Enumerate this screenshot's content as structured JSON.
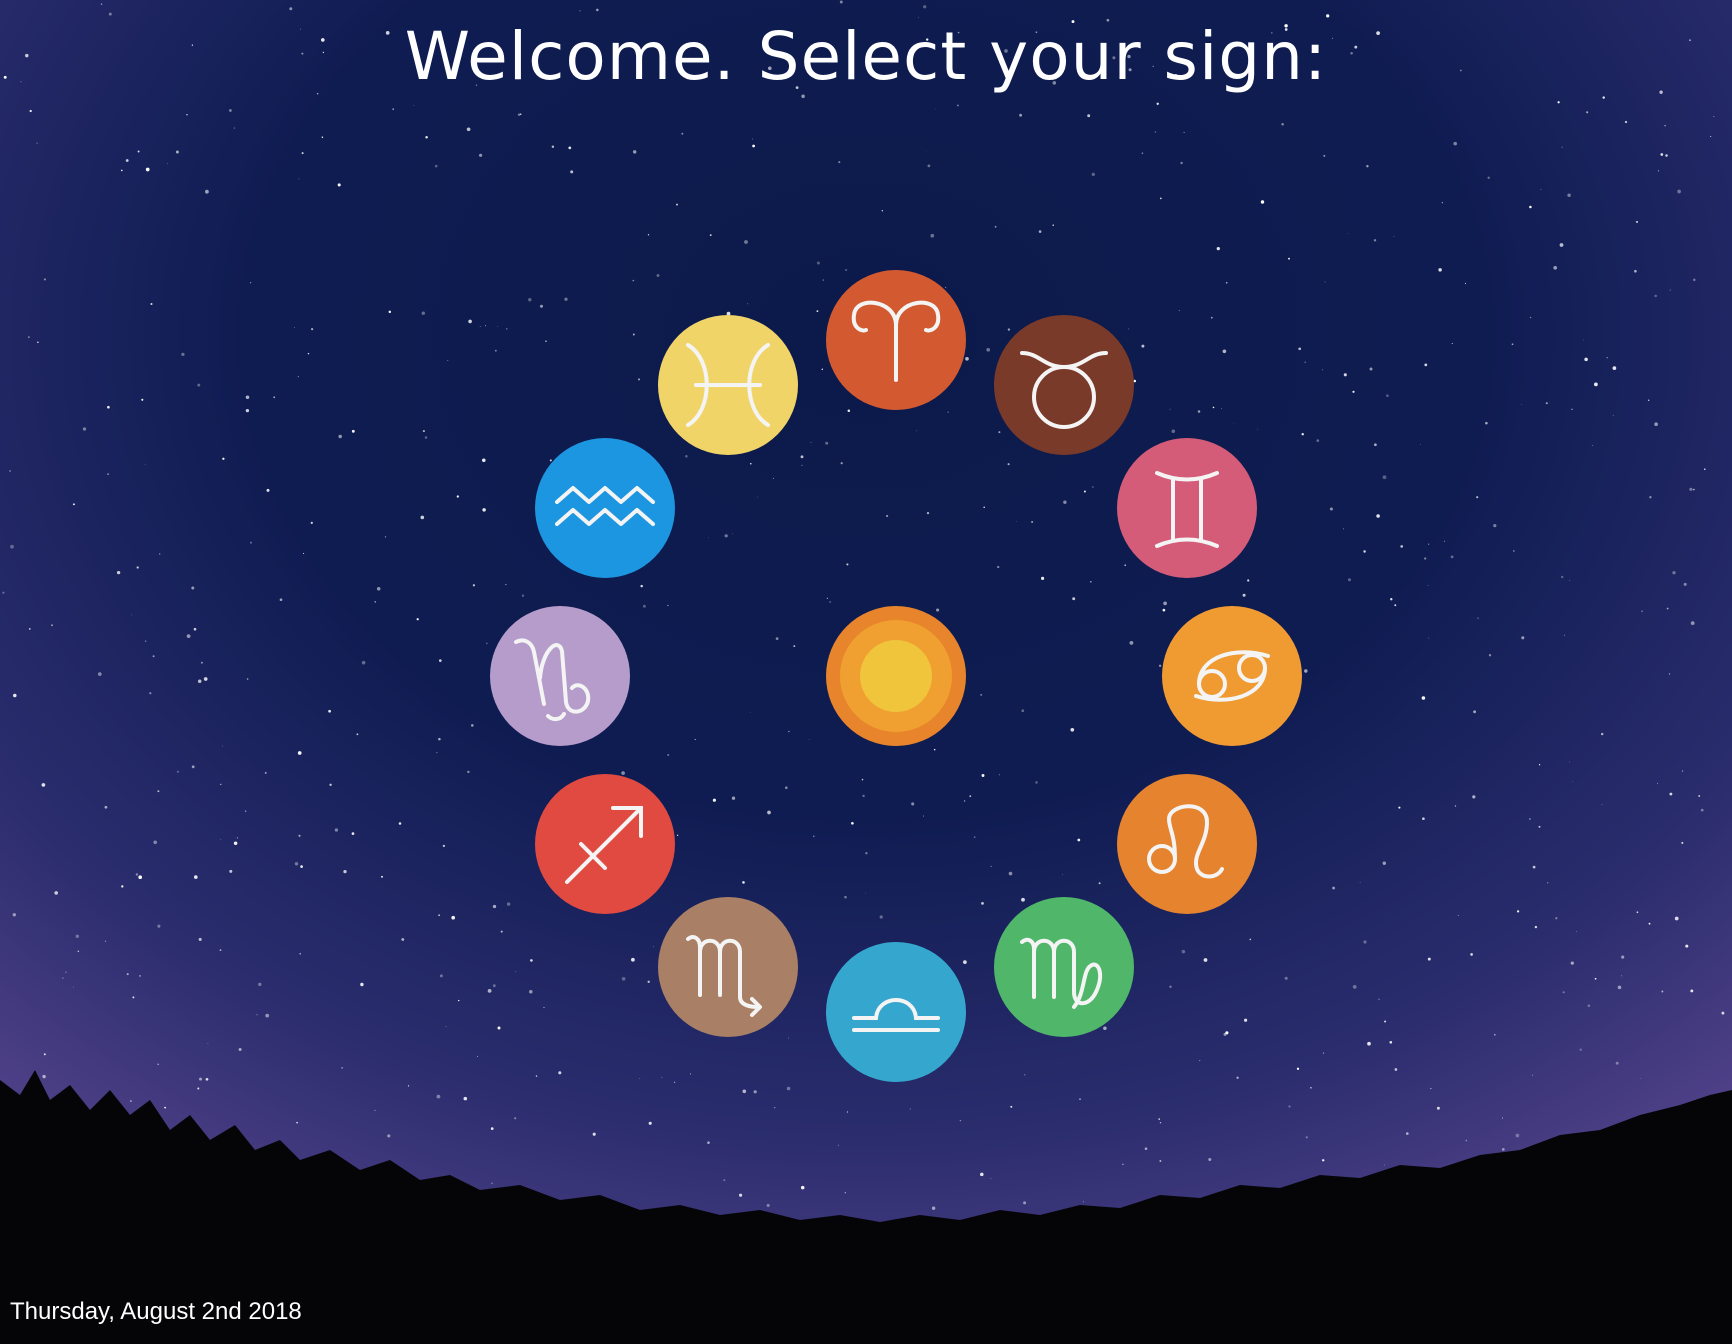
{
  "header": {
    "title": "Welcome. Select your sign:"
  },
  "footer": {
    "date": "Thursday, August 2nd 2018"
  },
  "center": {
    "icon": "sun-icon",
    "colors": {
      "outer": "#e8852c",
      "middle": "#f0a030",
      "inner": "#f0c53c"
    }
  },
  "signs": [
    {
      "name": "aries",
      "icon": "aries-icon",
      "color": "#d35a30"
    },
    {
      "name": "taurus",
      "icon": "taurus-icon",
      "color": "#7a3a2a"
    },
    {
      "name": "gemini",
      "icon": "gemini-icon",
      "color": "#d45c78"
    },
    {
      "name": "cancer",
      "icon": "cancer-icon",
      "color": "#f09a32"
    },
    {
      "name": "leo",
      "icon": "leo-icon",
      "color": "#e6832e"
    },
    {
      "name": "virgo",
      "icon": "virgo-icon",
      "color": "#4fb66a"
    },
    {
      "name": "libra",
      "icon": "libra-icon",
      "color": "#35a7cf"
    },
    {
      "name": "scorpio",
      "icon": "scorpio-icon",
      "color": "#a98065"
    },
    {
      "name": "sagittarius",
      "icon": "sagittarius-icon",
      "color": "#e14a40"
    },
    {
      "name": "capricorn",
      "icon": "capricorn-icon",
      "color": "#b59ccb"
    },
    {
      "name": "aquarius",
      "icon": "aquarius-icon",
      "color": "#1c96e0"
    },
    {
      "name": "pisces",
      "icon": "pisces-icon",
      "color": "#f0d468"
    }
  ]
}
